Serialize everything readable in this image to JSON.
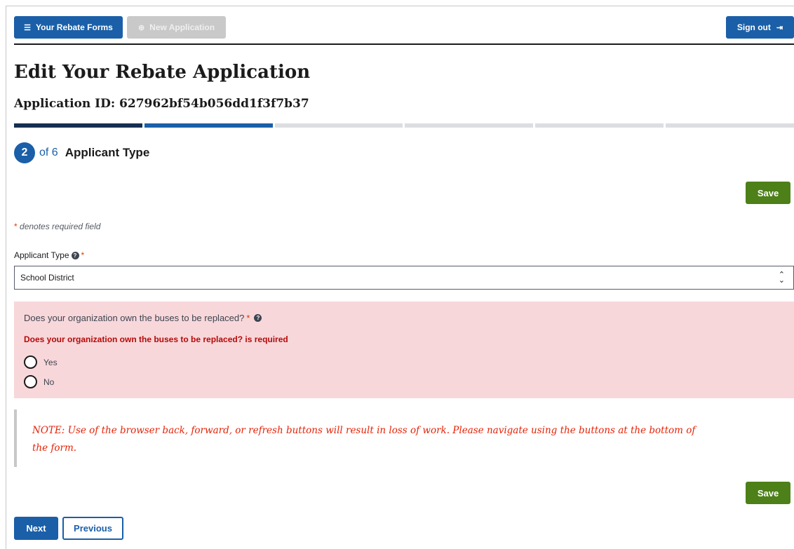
{
  "topbar": {
    "rebate_forms_label": "Your Rebate Forms",
    "new_application_label": "New Application",
    "sign_out_label": "Sign out"
  },
  "page": {
    "title": "Edit Your Rebate Application",
    "application_id": "Application ID: 627962bf54b056dd1f3f7b37"
  },
  "progress": {
    "current_step": 2,
    "total_steps": 6
  },
  "step": {
    "number": "2",
    "of_text": "of 6",
    "title": "Applicant Type"
  },
  "form": {
    "save_label": "Save",
    "required_star": "*",
    "required_note": "denotes required field",
    "applicant_type_label": "Applicant Type",
    "applicant_type_value": "School District",
    "own_buses_question": "Does your organization own the buses to be replaced?",
    "own_buses_error": "Does your organization own the buses to be replaced? is required",
    "option_yes": "Yes",
    "option_no": "No"
  },
  "note": {
    "text": "NOTE: Use of the browser back, forward, or refresh buttons will result in loss of work. Please navigate using the buttons at the bottom of the form."
  },
  "nav": {
    "next_label": "Next",
    "previous_label": "Previous"
  },
  "colors": {
    "primary": "#1a5fa8",
    "save_green": "#4d8018",
    "error_bg": "#f8d7da",
    "error_text": "#b50909",
    "note_text": "#e52207"
  }
}
